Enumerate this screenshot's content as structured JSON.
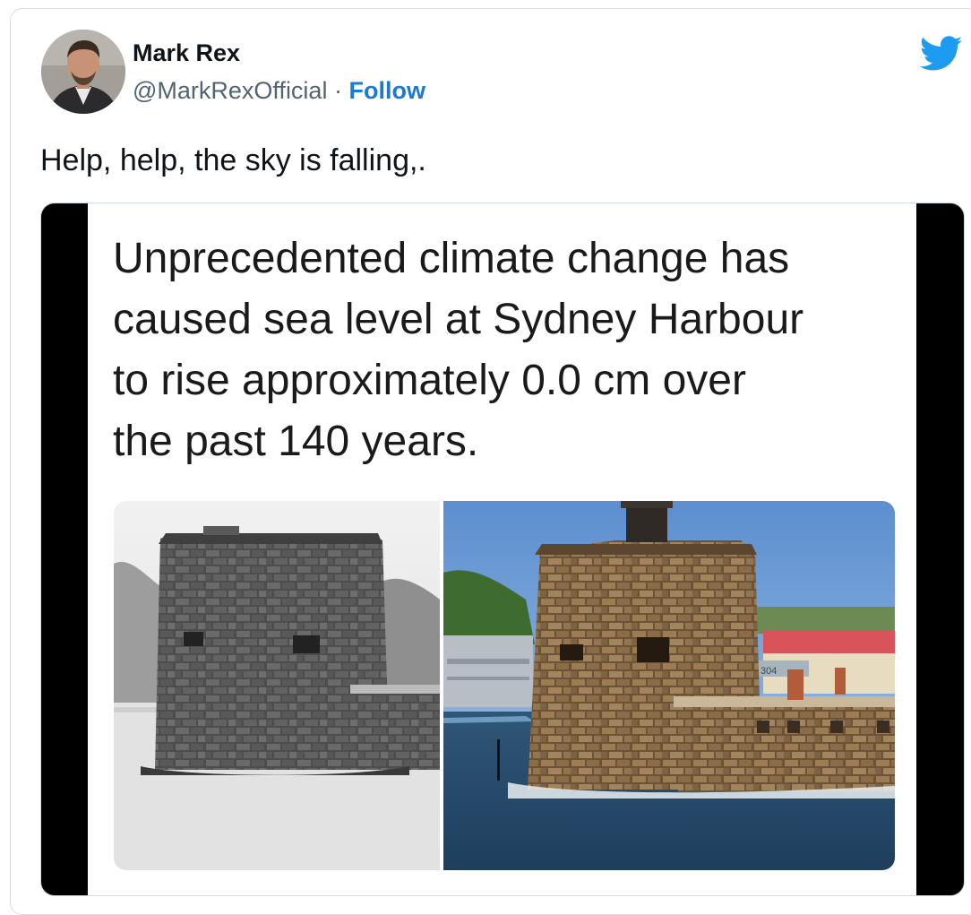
{
  "author": {
    "name": "Mark Rex",
    "handle": "@MarkRexOfficial",
    "separator": "·",
    "follow_label": "Follow"
  },
  "tweet": {
    "text": "Help, help, the sky is falling,."
  },
  "media": {
    "headline_lines": [
      "Unprecedented climate change has",
      "caused sea level at Sydney Harbour",
      "to rise approximately 0.0 cm over",
      "the past 140 years."
    ],
    "ship_number": "304"
  },
  "icons": {
    "brand": "twitter-bird-icon"
  },
  "colors": {
    "follow": "#1b79d0",
    "twitter_blue": "#1d9bf0",
    "text": "#0f1419",
    "secondary": "#536471"
  }
}
